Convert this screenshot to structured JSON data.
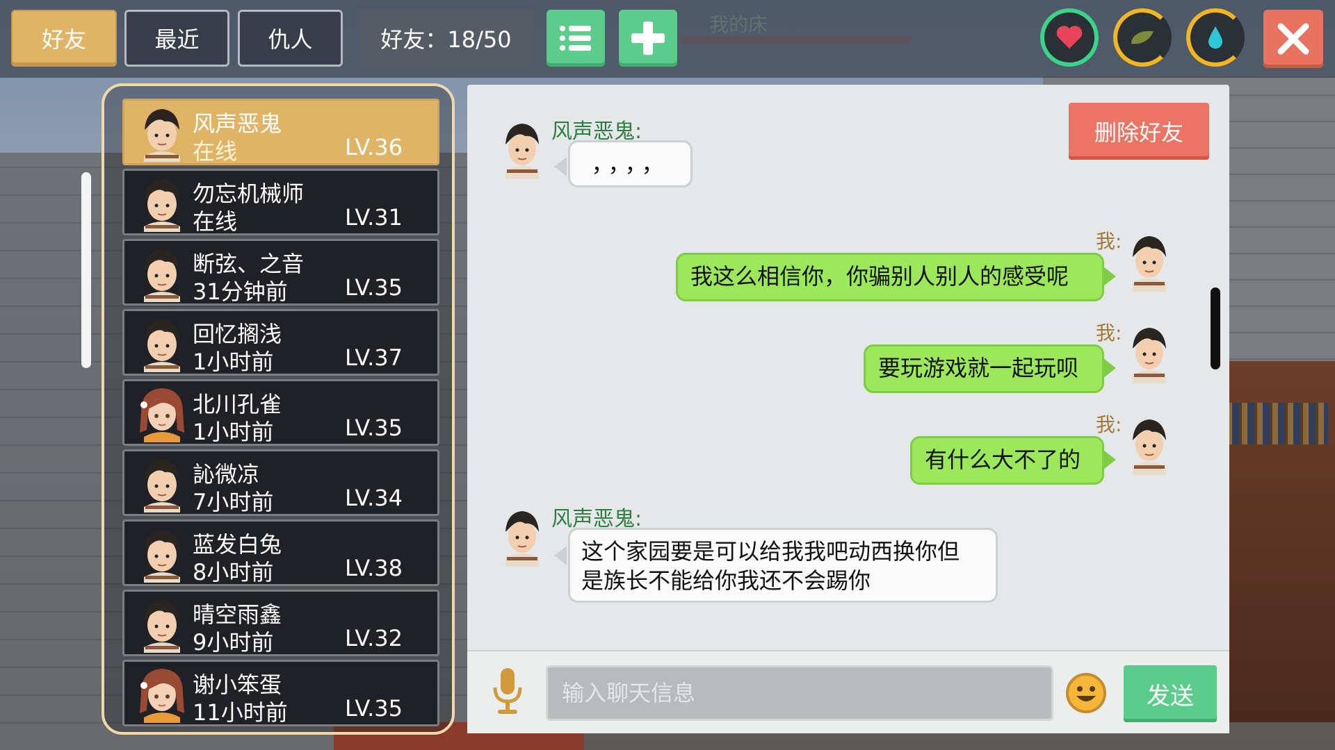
{
  "tabs": {
    "friends": "好友",
    "recent": "最近",
    "enemies": "仇人"
  },
  "friend_count": "好友：18/50",
  "background_title": "我的床",
  "icons": {
    "list": "list-icon",
    "add": "plus-icon",
    "health": "heart-icon",
    "hunger": "food-icon",
    "thirst": "water-drop-icon",
    "close": "close-icon",
    "mic": "microphone-icon",
    "emoji": "emoji-icon"
  },
  "colors": {
    "tab_active": "#e0b466",
    "green": "#5ccc8a",
    "danger": "#ec7462",
    "bubble_me": "#9be85a",
    "sender_name": "#2e7f44"
  },
  "friends": [
    {
      "name": "风声恶鬼",
      "status": "在线",
      "level": "LV.36",
      "avatar": "boy",
      "active": true
    },
    {
      "name": "勿忘机械师",
      "status": "在线",
      "level": "LV.31",
      "avatar": "boy",
      "active": false
    },
    {
      "name": "断弦、之音",
      "status": "31分钟前",
      "level": "LV.35",
      "avatar": "boy",
      "active": false
    },
    {
      "name": "回忆搁浅",
      "status": "1小时前",
      "level": "LV.37",
      "avatar": "boy",
      "active": false
    },
    {
      "name": "北川孔雀",
      "status": "1小时前",
      "level": "LV.35",
      "avatar": "girl",
      "active": false
    },
    {
      "name": "訫微凉",
      "status": "7小时前",
      "level": "LV.34",
      "avatar": "boy",
      "active": false
    },
    {
      "name": "蓝发白兔",
      "status": "8小时前",
      "level": "LV.38",
      "avatar": "boy",
      "active": false
    },
    {
      "name": "晴空雨鑫",
      "status": "9小时前",
      "level": "LV.32",
      "avatar": "boy",
      "active": false
    },
    {
      "name": "谢小笨蛋",
      "status": "11小时前",
      "level": "LV.35",
      "avatar": "girl",
      "active": false
    }
  ],
  "chat": {
    "delete_label": "删除好友",
    "messages": [
      {
        "from": "friend",
        "sender": "风声恶鬼:",
        "text": "，，，，"
      },
      {
        "from": "me",
        "sender": "我:",
        "text": "我这么相信你，你骗别人别人的感受呢"
      },
      {
        "from": "me",
        "sender": "我:",
        "text": "要玩游戏就一起玩呗"
      },
      {
        "from": "me",
        "sender": "我:",
        "text": "有什么大不了的"
      },
      {
        "from": "friend",
        "sender": "风声恶鬼:",
        "text_line1": "这个家园要是可以给我我吧动西换你但",
        "text_line2": "是族长不能给你我还不会踢你"
      }
    ],
    "input_placeholder": "输入聊天信息",
    "input_value": "",
    "send_label": "发送"
  }
}
